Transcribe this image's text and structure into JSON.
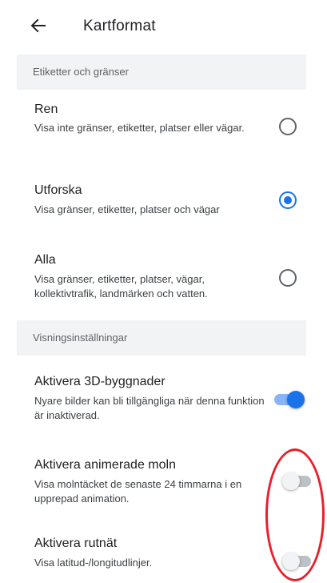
{
  "header": {
    "back_icon": "arrow-back-icon",
    "title": "Kartformat"
  },
  "sections": {
    "labels_and_borders": "Etiketter och gränser",
    "display_settings": "Visningsinställningar"
  },
  "map_styles": [
    {
      "title": "Ren",
      "description": "Visa inte gränser, etiketter, platser eller vägar.",
      "selected": false
    },
    {
      "title": "Utforska",
      "description": "Visa gränser, etiketter, platser och vägar",
      "selected": true
    },
    {
      "title": "Alla",
      "description": "Visa gränser, etiketter, platser, vägar, kollektivtrafik, landmärken och vatten.",
      "selected": false
    }
  ],
  "display_options": [
    {
      "title": "Aktivera 3D-byggnader",
      "description": "Nyare bilder kan bli tillgängliga när denna funktion är inaktiverad.",
      "enabled": true
    },
    {
      "title": "Aktivera animerade moln",
      "description": "Visa molntäcket de senaste 24 timmarna i en upprepad animation.",
      "enabled": false
    },
    {
      "title": "Aktivera rutnät",
      "description": "Visa latitud-/longitudlinjer.",
      "enabled": false
    }
  ],
  "colors": {
    "accent": "#1a73e8",
    "section_background": "#f1f3f4",
    "annotation": "#e8202a"
  }
}
